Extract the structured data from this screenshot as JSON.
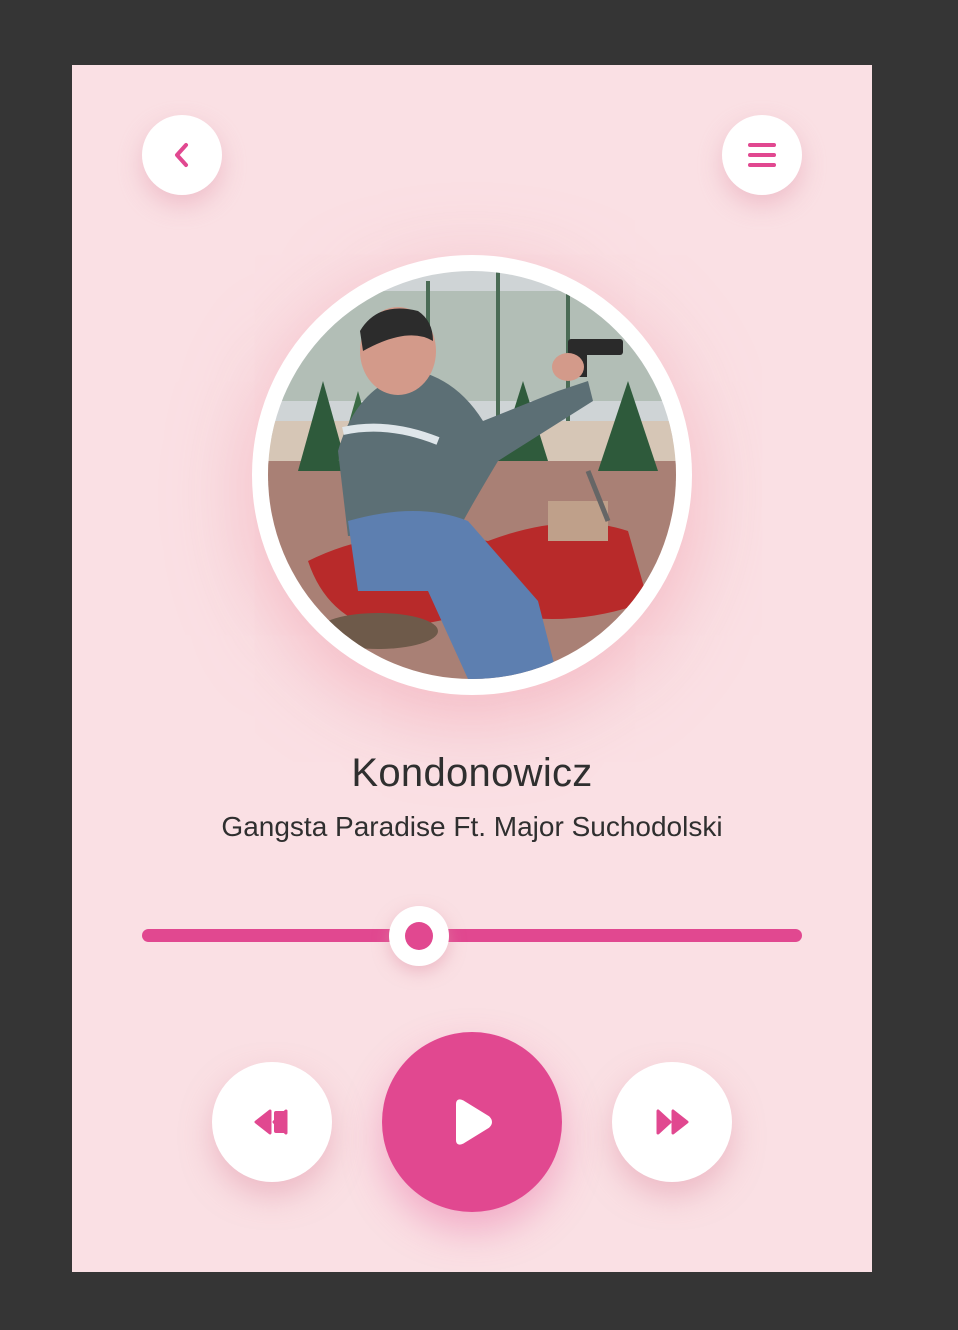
{
  "app": {
    "background_color": "#353535",
    "card_color": "#fae0e4",
    "accent_color": "#e14890"
  },
  "header": {
    "back_icon": "chevron-left-icon",
    "menu_icon": "hamburger-menu-icon"
  },
  "album_art": {
    "icon": "album-cover-image",
    "description_alt": "Album cover"
  },
  "track": {
    "title": "Kondonowicz",
    "artist": "Gangsta Paradise Ft. Major Suchodolski"
  },
  "progress": {
    "fraction": 0.42
  },
  "controls": {
    "rewind_icon": "rewind-icon",
    "play_icon": "play-icon",
    "forward_icon": "fast-forward-icon"
  }
}
